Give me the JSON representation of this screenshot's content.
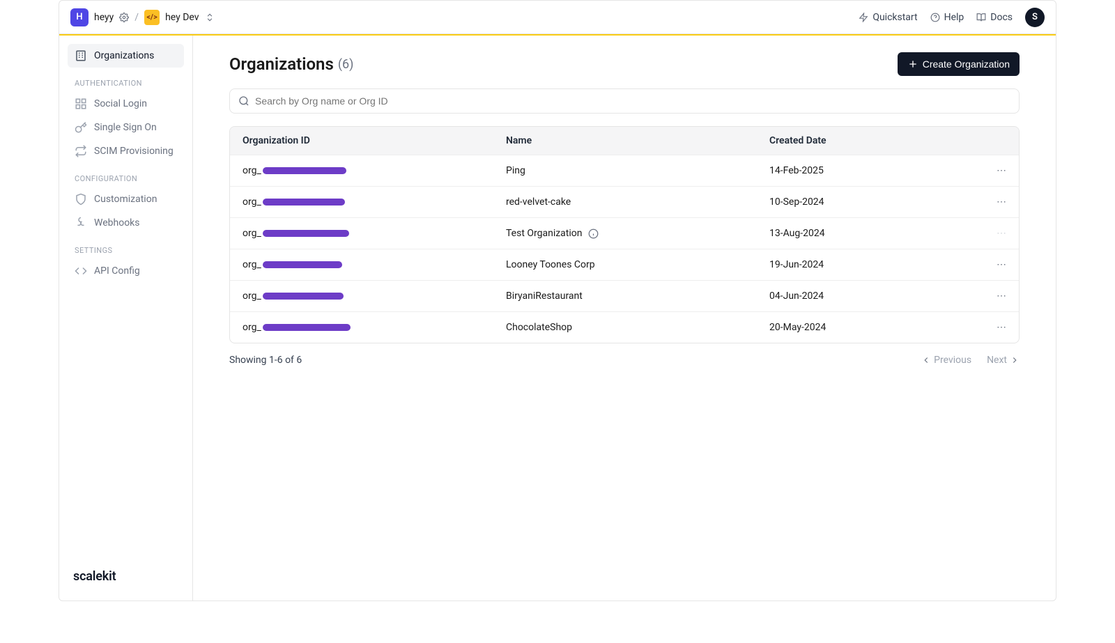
{
  "header": {
    "app_initial": "H",
    "app_name": "heyy",
    "env_icon": "</>",
    "env_name": "hey Dev",
    "quickstart": "Quickstart",
    "help": "Help",
    "docs": "Docs",
    "avatar_initial": "S"
  },
  "sidebar": {
    "items_top": [
      {
        "label": "Organizations",
        "icon": "building"
      }
    ],
    "section_auth": "AUTHENTICATION",
    "items_auth": [
      {
        "label": "Social Login",
        "icon": "grid"
      },
      {
        "label": "Single Sign On",
        "icon": "key"
      },
      {
        "label": "SCIM Provisioning",
        "icon": "arrows"
      }
    ],
    "section_config": "CONFIGURATION",
    "items_config": [
      {
        "label": "Customization",
        "icon": "shield"
      },
      {
        "label": "Webhooks",
        "icon": "webhook"
      }
    ],
    "section_settings": "SETTINGS",
    "items_settings": [
      {
        "label": "API Config",
        "icon": "code"
      }
    ],
    "brand": "scalekit"
  },
  "page": {
    "title": "Organizations",
    "count": "(6)",
    "create_label": "Create Organization",
    "search_placeholder": "Search by Org name or Org ID"
  },
  "table": {
    "columns": [
      "Organization ID",
      "Name",
      "Created Date"
    ],
    "rows": [
      {
        "org_prefix": "org_",
        "redact_w": 120,
        "name": "Ping",
        "info": false,
        "date": "14-Feb-2025",
        "actions": true
      },
      {
        "org_prefix": "org_",
        "redact_w": 118,
        "name": "red-velvet-cake",
        "info": false,
        "date": "10-Sep-2024",
        "actions": true
      },
      {
        "org_prefix": "org_",
        "redact_w": 124,
        "name": "Test Organization",
        "info": true,
        "date": "13-Aug-2024",
        "actions": false
      },
      {
        "org_prefix": "org_",
        "redact_w": 114,
        "name": "Looney Toones Corp",
        "info": false,
        "date": "19-Jun-2024",
        "actions": true
      },
      {
        "org_prefix": "org_",
        "redact_w": 116,
        "name": "BiryaniRestaurant",
        "info": false,
        "date": "04-Jun-2024",
        "actions": true
      },
      {
        "org_prefix": "org_",
        "redact_w": 126,
        "name": "ChocolateShop",
        "info": false,
        "date": "20-May-2024",
        "actions": true
      }
    ]
  },
  "footer": {
    "showing": "Showing 1-6 of 6",
    "prev": "Previous",
    "next": "Next"
  }
}
